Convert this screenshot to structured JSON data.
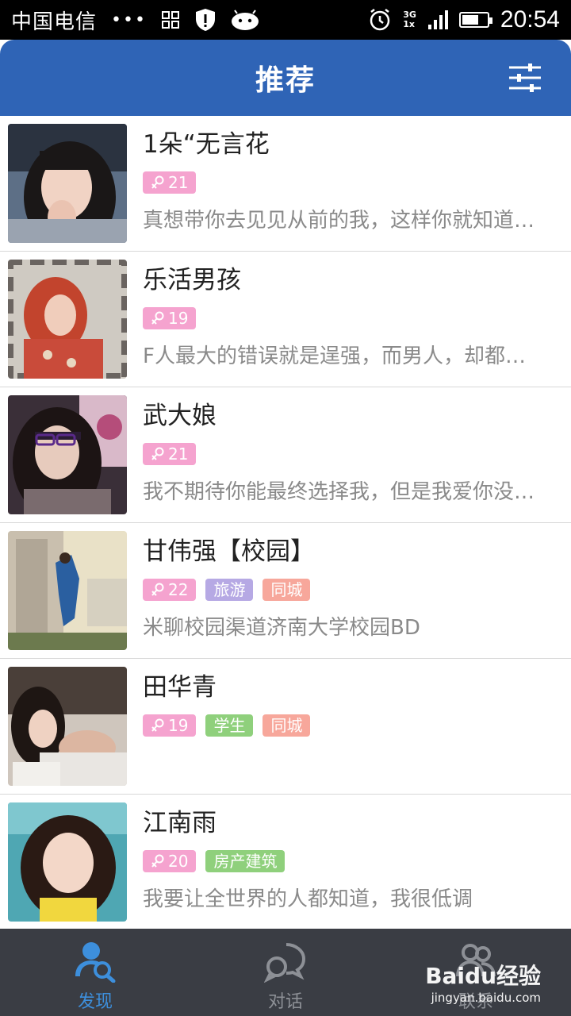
{
  "status_bar": {
    "carrier": "中国电信",
    "dots": "•••",
    "network_top": "3G",
    "network_bottom": "1x",
    "time": "20:54"
  },
  "header": {
    "title": "推荐"
  },
  "users": [
    {
      "name": "1朵“无言花",
      "age": "21",
      "tags": [],
      "signature": "真想带你去见见从前的我，这样你就知道…"
    },
    {
      "name": "乐活男孩",
      "age": "19",
      "tags": [],
      "signature": "F人最大的错误就是逞强，而男人，却都…"
    },
    {
      "name": "武大娘",
      "age": "21",
      "tags": [],
      "signature": "我不期待你能最终选择我，但是我爱你没…"
    },
    {
      "name": "甘伟强【校园】",
      "age": "22",
      "tags": [
        "旅游",
        "同城"
      ],
      "signature": "米聊校园渠道济南大学校园BD"
    },
    {
      "name": "田华青",
      "age": "19",
      "tags": [
        "学生",
        "同城"
      ],
      "signature": ""
    },
    {
      "name": "江南雨",
      "age": "20",
      "tags": [
        "房产建筑"
      ],
      "signature": "我要让全世界的人都知道，我很低调"
    }
  ],
  "bottom_nav": {
    "items": [
      {
        "label": "发现",
        "icon": "discover-user-search-icon",
        "active": true
      },
      {
        "label": "对话",
        "icon": "chat-bubble-icon",
        "active": false
      },
      {
        "label": "联系",
        "icon": "contacts-icon",
        "active": false
      }
    ]
  },
  "watermark": {
    "main": "Baidu经验",
    "sub": "jingyan.baidu.com"
  },
  "colors": {
    "header_bg": "#2f64b6",
    "nav_bg": "#3a3d44",
    "active_blue": "#3d8fdc",
    "age_tag": "#f5a3cf",
    "travel_tag": "#b6a9e4",
    "city_tag": "#f7a79b",
    "green_tag": "#8fd07c"
  }
}
